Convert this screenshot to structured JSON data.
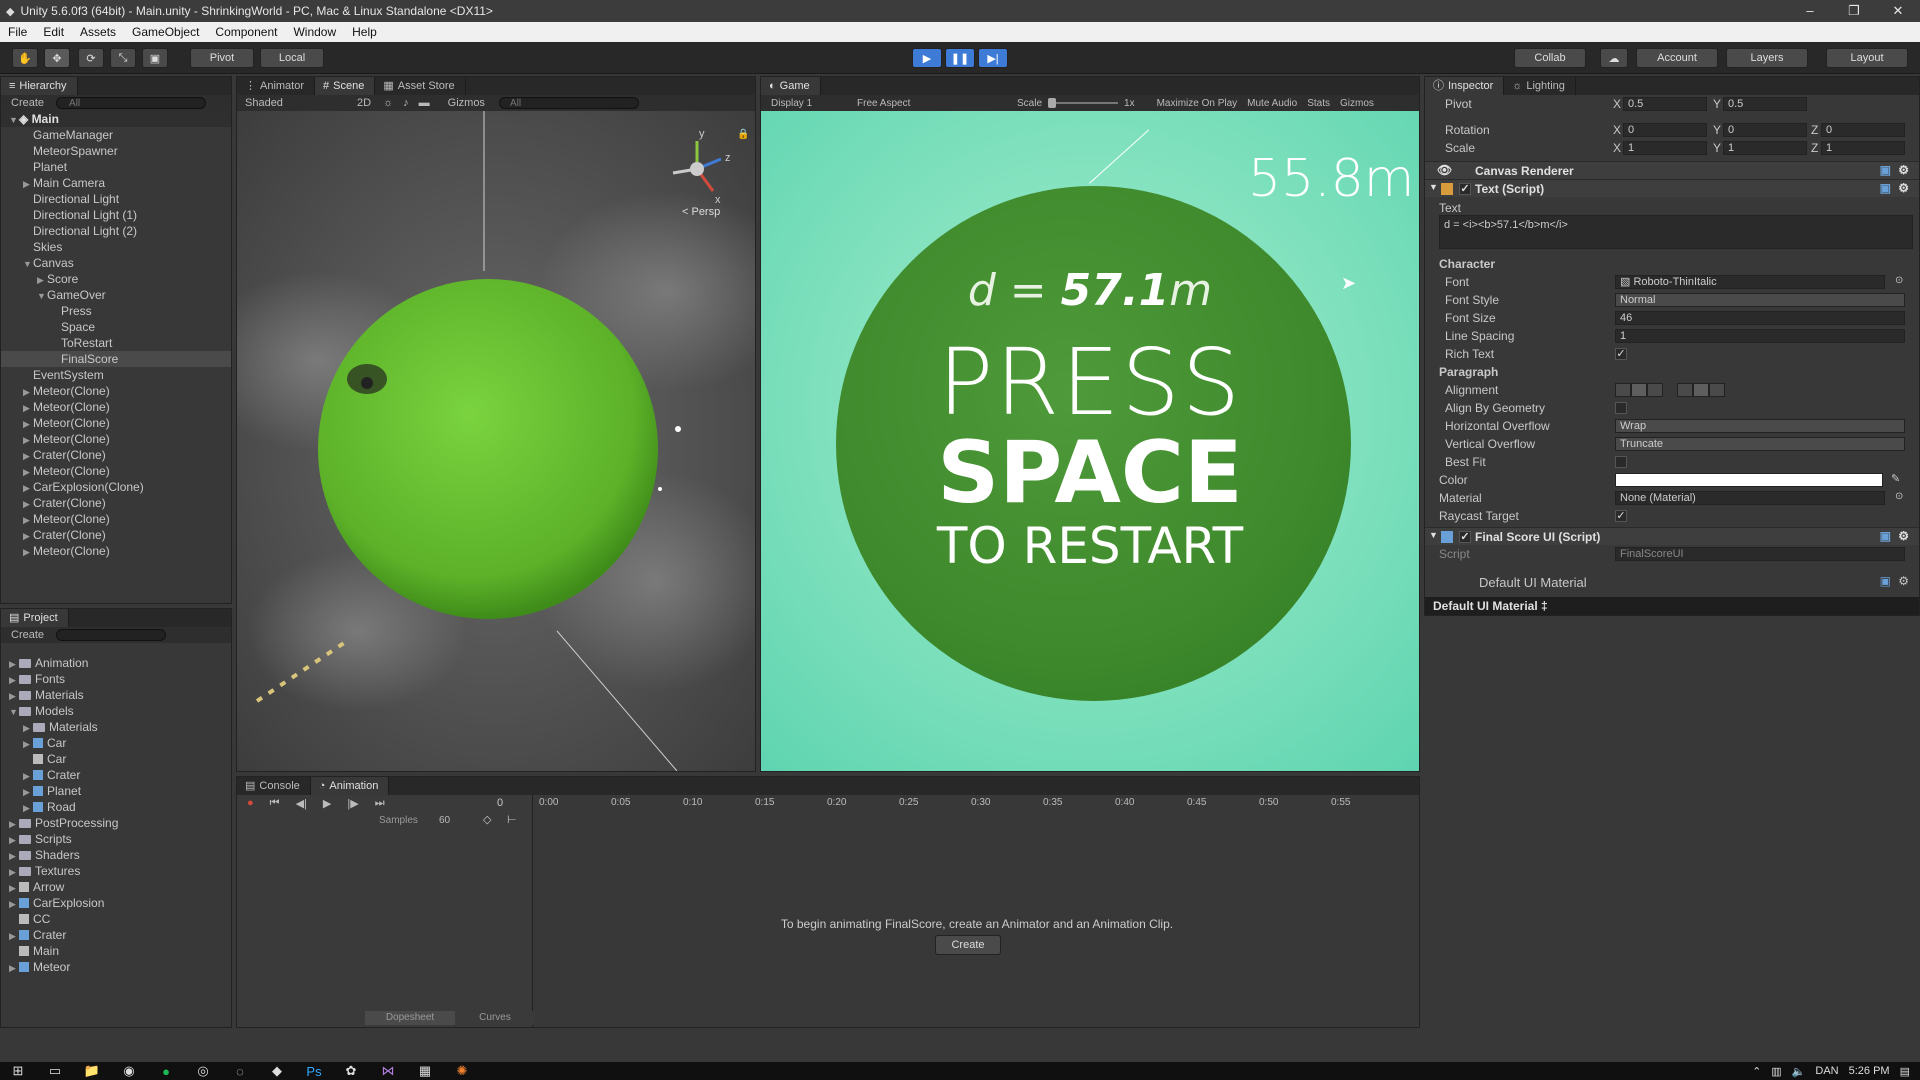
{
  "window": {
    "title": "Unity 5.6.0f3 (64bit) - Main.unity - ShrinkingWorld - PC, Mac & Linux Standalone <DX11>",
    "minimize": "–",
    "restore": "❐",
    "close": "✕"
  },
  "menu": [
    "File",
    "Edit",
    "Assets",
    "GameObject",
    "Component",
    "Window",
    "Help"
  ],
  "toolbar": {
    "pivot": "Pivot",
    "local": "Local",
    "collab": "Collab",
    "account": "Account",
    "layers": "Layers",
    "layout": "Layout"
  },
  "hierarchy": {
    "tab": "Hierarchy",
    "create": "Create",
    "search_placeholder": "All",
    "scene": "Main",
    "items": [
      {
        "label": "GameManager",
        "depth": 1,
        "arrow": ""
      },
      {
        "label": "MeteorSpawner",
        "depth": 1,
        "arrow": ""
      },
      {
        "label": "Planet",
        "depth": 1,
        "arrow": ""
      },
      {
        "label": "Main Camera",
        "depth": 1,
        "arrow": "▶"
      },
      {
        "label": "Directional Light",
        "depth": 1,
        "arrow": ""
      },
      {
        "label": "Directional Light (1)",
        "depth": 1,
        "arrow": ""
      },
      {
        "label": "Directional Light (2)",
        "depth": 1,
        "arrow": ""
      },
      {
        "label": "Skies",
        "depth": 1,
        "arrow": ""
      },
      {
        "label": "Canvas",
        "depth": 1,
        "arrow": "▼"
      },
      {
        "label": "Score",
        "depth": 2,
        "arrow": "▶"
      },
      {
        "label": "GameOver",
        "depth": 2,
        "arrow": "▼"
      },
      {
        "label": "Press",
        "depth": 3,
        "arrow": ""
      },
      {
        "label": "Space",
        "depth": 3,
        "arrow": ""
      },
      {
        "label": "ToRestart",
        "depth": 3,
        "arrow": ""
      },
      {
        "label": "FinalScore",
        "depth": 3,
        "arrow": "",
        "selected": true
      },
      {
        "label": "EventSystem",
        "depth": 1,
        "arrow": ""
      },
      {
        "label": "Meteor(Clone)",
        "depth": 1,
        "arrow": "▶"
      },
      {
        "label": "Meteor(Clone)",
        "depth": 1,
        "arrow": "▶"
      },
      {
        "label": "Meteor(Clone)",
        "depth": 1,
        "arrow": "▶"
      },
      {
        "label": "Meteor(Clone)",
        "depth": 1,
        "arrow": "▶"
      },
      {
        "label": "Crater(Clone)",
        "depth": 1,
        "arrow": "▶"
      },
      {
        "label": "Meteor(Clone)",
        "depth": 1,
        "arrow": "▶"
      },
      {
        "label": "CarExplosion(Clone)",
        "depth": 1,
        "arrow": "▶"
      },
      {
        "label": "Crater(Clone)",
        "depth": 1,
        "arrow": "▶"
      },
      {
        "label": "Meteor(Clone)",
        "depth": 1,
        "arrow": "▶"
      },
      {
        "label": "Crater(Clone)",
        "depth": 1,
        "arrow": "▶"
      },
      {
        "label": "Meteor(Clone)",
        "depth": 1,
        "arrow": "▶"
      }
    ]
  },
  "project": {
    "tab": "Project",
    "create": "Create",
    "items": [
      {
        "label": "Animation",
        "depth": 0,
        "arrow": "▶",
        "icon": "folder"
      },
      {
        "label": "Fonts",
        "depth": 0,
        "arrow": "▶",
        "icon": "folder"
      },
      {
        "label": "Materials",
        "depth": 0,
        "arrow": "▶",
        "icon": "folder"
      },
      {
        "label": "Models",
        "depth": 0,
        "arrow": "▼",
        "icon": "folder"
      },
      {
        "label": "Materials",
        "depth": 1,
        "arrow": "▶",
        "icon": "folder"
      },
      {
        "label": "Car",
        "depth": 1,
        "arrow": "▶",
        "icon": "model"
      },
      {
        "label": "Car",
        "depth": 1,
        "arrow": "",
        "icon": "file"
      },
      {
        "label": "Crater",
        "depth": 1,
        "arrow": "▶",
        "icon": "model"
      },
      {
        "label": "Planet",
        "depth": 1,
        "arrow": "▶",
        "icon": "model"
      },
      {
        "label": "Road",
        "depth": 1,
        "arrow": "▶",
        "icon": "model"
      },
      {
        "label": "PostProcessing",
        "depth": 0,
        "arrow": "▶",
        "icon": "folder"
      },
      {
        "label": "Scripts",
        "depth": 0,
        "arrow": "▶",
        "icon": "folder"
      },
      {
        "label": "Shaders",
        "depth": 0,
        "arrow": "▶",
        "icon": "folder"
      },
      {
        "label": "Textures",
        "depth": 0,
        "arrow": "▶",
        "icon": "folder"
      },
      {
        "label": "Arrow",
        "depth": 0,
        "arrow": "▶",
        "icon": "anim"
      },
      {
        "label": "CarExplosion",
        "depth": 0,
        "arrow": "▶",
        "icon": "prefab"
      },
      {
        "label": "CC",
        "depth": 0,
        "arrow": "",
        "icon": "asset"
      },
      {
        "label": "Crater",
        "depth": 0,
        "arrow": "▶",
        "icon": "prefab"
      },
      {
        "label": "Main",
        "depth": 0,
        "arrow": "",
        "icon": "unity"
      },
      {
        "label": "Meteor",
        "depth": 0,
        "arrow": "▶",
        "icon": "prefab"
      }
    ]
  },
  "scene": {
    "tabs": [
      "Animator",
      "Scene",
      "Asset Store"
    ],
    "shading": "Shaded",
    "mode2d": "2D",
    "gizmos": "Gizmos",
    "search": "All",
    "persp": "< Persp",
    "axis_y": "y",
    "axis_z": "z",
    "axis_x": "x"
  },
  "game": {
    "tab": "Game",
    "display": "Display 1",
    "aspect": "Free Aspect",
    "scale": "Scale",
    "scale_val": "1x",
    "maximize": "Maximize On Play",
    "mute": "Mute Audio",
    "stats": "Stats",
    "gizmos": "Gizmos",
    "distance": "55.8m",
    "score_prefix": "d = ",
    "score_value": "57.1",
    "score_unit": "m",
    "line1": "PRESS",
    "line2": "SPACE",
    "line3": "TO RESTART"
  },
  "inspector": {
    "tabs": [
      "Inspector",
      "Lighting"
    ],
    "pivot": {
      "label": "Pivot",
      "x": "0.5",
      "y": "0.5"
    },
    "rotation": {
      "label": "Rotation",
      "x": "0",
      "y": "0",
      "z": "0"
    },
    "scale": {
      "label": "Scale",
      "x": "1",
      "y": "1",
      "z": "1"
    },
    "canvas_renderer": "Canvas Renderer",
    "text_script": "Text (Script)",
    "text_label": "Text",
    "text_value": "d = <i><b>57.1</b>m</i>",
    "character": "Character",
    "font": {
      "label": "Font",
      "value": "Roboto-ThinItalic"
    },
    "font_style": {
      "label": "Font Style",
      "value": "Normal"
    },
    "font_size": {
      "label": "Font Size",
      "value": "46"
    },
    "line_spacing": {
      "label": "Line Spacing",
      "value": "1"
    },
    "rich_text": {
      "label": "Rich Text",
      "value": "✓"
    },
    "paragraph": "Paragraph",
    "alignment": "Alignment",
    "align_geometry": "Align By Geometry",
    "h_overflow": {
      "label": "Horizontal Overflow",
      "value": "Wrap"
    },
    "v_overflow": {
      "label": "Vertical Overflow",
      "value": "Truncate"
    },
    "best_fit": "Best Fit",
    "color": "Color",
    "material": {
      "label": "Material",
      "value": "None (Material)"
    },
    "raycast": {
      "label": "Raycast Target",
      "value": "✓"
    },
    "final_score": "Final Score UI (Script)",
    "script": {
      "label": "Script",
      "value": "FinalScoreUI"
    },
    "default_material": "Default UI Material",
    "default_material_bar": "Default UI Material ‡",
    "x": "X",
    "y": "Y",
    "z": "Z"
  },
  "animation": {
    "tabs": [
      "Console",
      "Animation"
    ],
    "frame": "0",
    "samples_label": "Samples",
    "samples": "60",
    "ticks": [
      "0:00",
      "0:05",
      "0:10",
      "0:15",
      "0:20",
      "0:25",
      "0:30",
      "0:35",
      "0:40",
      "0:45",
      "0:50",
      "0:55"
    ],
    "message": "To begin animating FinalScore, create an Animator and an Animation Clip.",
    "create": "Create",
    "dopesheet": "Dopesheet",
    "curves": "Curves"
  },
  "taskbar": {
    "lang": "DAN",
    "time": "5:26 PM"
  },
  "colors": {
    "accent": "#3d7bd6",
    "planet_green": "#64b830",
    "game_bg": "#8fe3c4"
  }
}
